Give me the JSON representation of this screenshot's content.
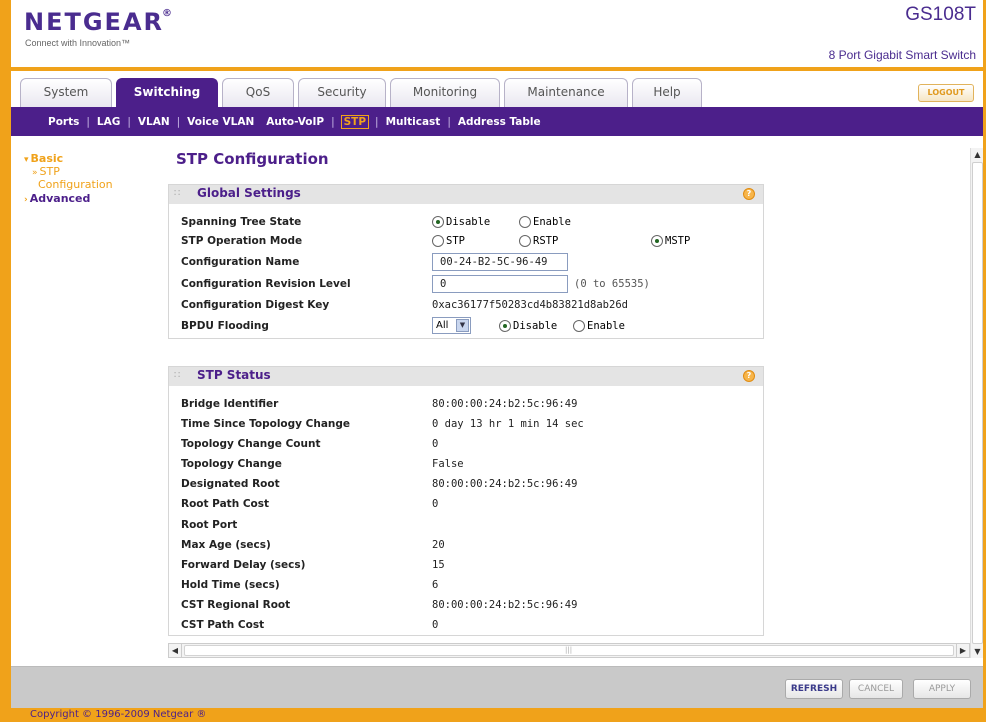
{
  "brand": {
    "logo_text": "NETGEAR",
    "reg_mark": "®",
    "tagline": "Connect with Innovation™",
    "model": "GS108T",
    "model_desc": "8 Port Gigabit Smart Switch"
  },
  "tabs": [
    {
      "label": "System"
    },
    {
      "label": "Switching",
      "active": true
    },
    {
      "label": "QoS"
    },
    {
      "label": "Security"
    },
    {
      "label": "Monitoring"
    },
    {
      "label": "Maintenance"
    },
    {
      "label": "Help"
    }
  ],
  "logout_label": "LOGOUT",
  "subnav": {
    "ports": "Ports",
    "lag": "LAG",
    "vlan": "VLAN",
    "voice_vlan": "Voice VLAN",
    "auto_voip": "Auto-VoIP",
    "stp": "STP",
    "multicast": "Multicast",
    "address_table": "Address Table"
  },
  "left_nav": {
    "basic": "Basic",
    "stp_line1": "STP",
    "stp_line2": "Configuration",
    "advanced": "Advanced"
  },
  "page_title": "STP Configuration",
  "global_settings": {
    "title": "Global Settings",
    "spanning_tree_state": {
      "label": "Spanning Tree State",
      "options": [
        "Disable",
        "Enable"
      ],
      "selected": "Disable"
    },
    "stp_operation_mode": {
      "label": "STP Operation Mode",
      "options": [
        "STP",
        "RSTP",
        "MSTP"
      ],
      "selected": "MSTP"
    },
    "configuration_name": {
      "label": "Configuration Name",
      "value": "00-24-B2-5C-96-49"
    },
    "configuration_revision_level": {
      "label": "Configuration Revision Level",
      "value": "0",
      "hint": "(0 to 65535)"
    },
    "configuration_digest_key": {
      "label": "Configuration Digest Key",
      "value": "0xac36177f50283cd4b83821d8ab26d"
    },
    "bpdu_flooding": {
      "label": "BPDU Flooding",
      "scope": "All",
      "options": [
        "Disable",
        "Enable"
      ],
      "selected": "Disable"
    }
  },
  "stp_status": {
    "title": "STP Status",
    "rows": [
      {
        "label": "Bridge Identifier",
        "value": "80:00:00:24:b2:5c:96:49"
      },
      {
        "label": "Time Since Topology Change",
        "value": "0 day 13 hr 1 min 14 sec"
      },
      {
        "label": "Topology Change Count",
        "value": "0"
      },
      {
        "label": "Topology Change",
        "value": "False"
      },
      {
        "label": "Designated Root",
        "value": "80:00:00:24:b2:5c:96:49"
      },
      {
        "label": "Root Path Cost",
        "value": "0"
      },
      {
        "label": "Root Port",
        "value": ""
      },
      {
        "label": "Max Age (secs)",
        "value": "20"
      },
      {
        "label": "Forward Delay (secs)",
        "value": "15"
      },
      {
        "label": "Hold Time (secs)",
        "value": "6"
      },
      {
        "label": "CST Regional Root",
        "value": "80:00:00:24:b2:5c:96:49"
      },
      {
        "label": "CST Path Cost",
        "value": "0"
      }
    ]
  },
  "buttons": {
    "refresh": "REFRESH",
    "cancel": "CANCEL",
    "apply": "APPLY"
  },
  "copyright": "Copyright © 1996-2009 Netgear ®",
  "colors": {
    "brand_purple": "#4c1f8a",
    "brand_orange": "#f0a21a"
  }
}
